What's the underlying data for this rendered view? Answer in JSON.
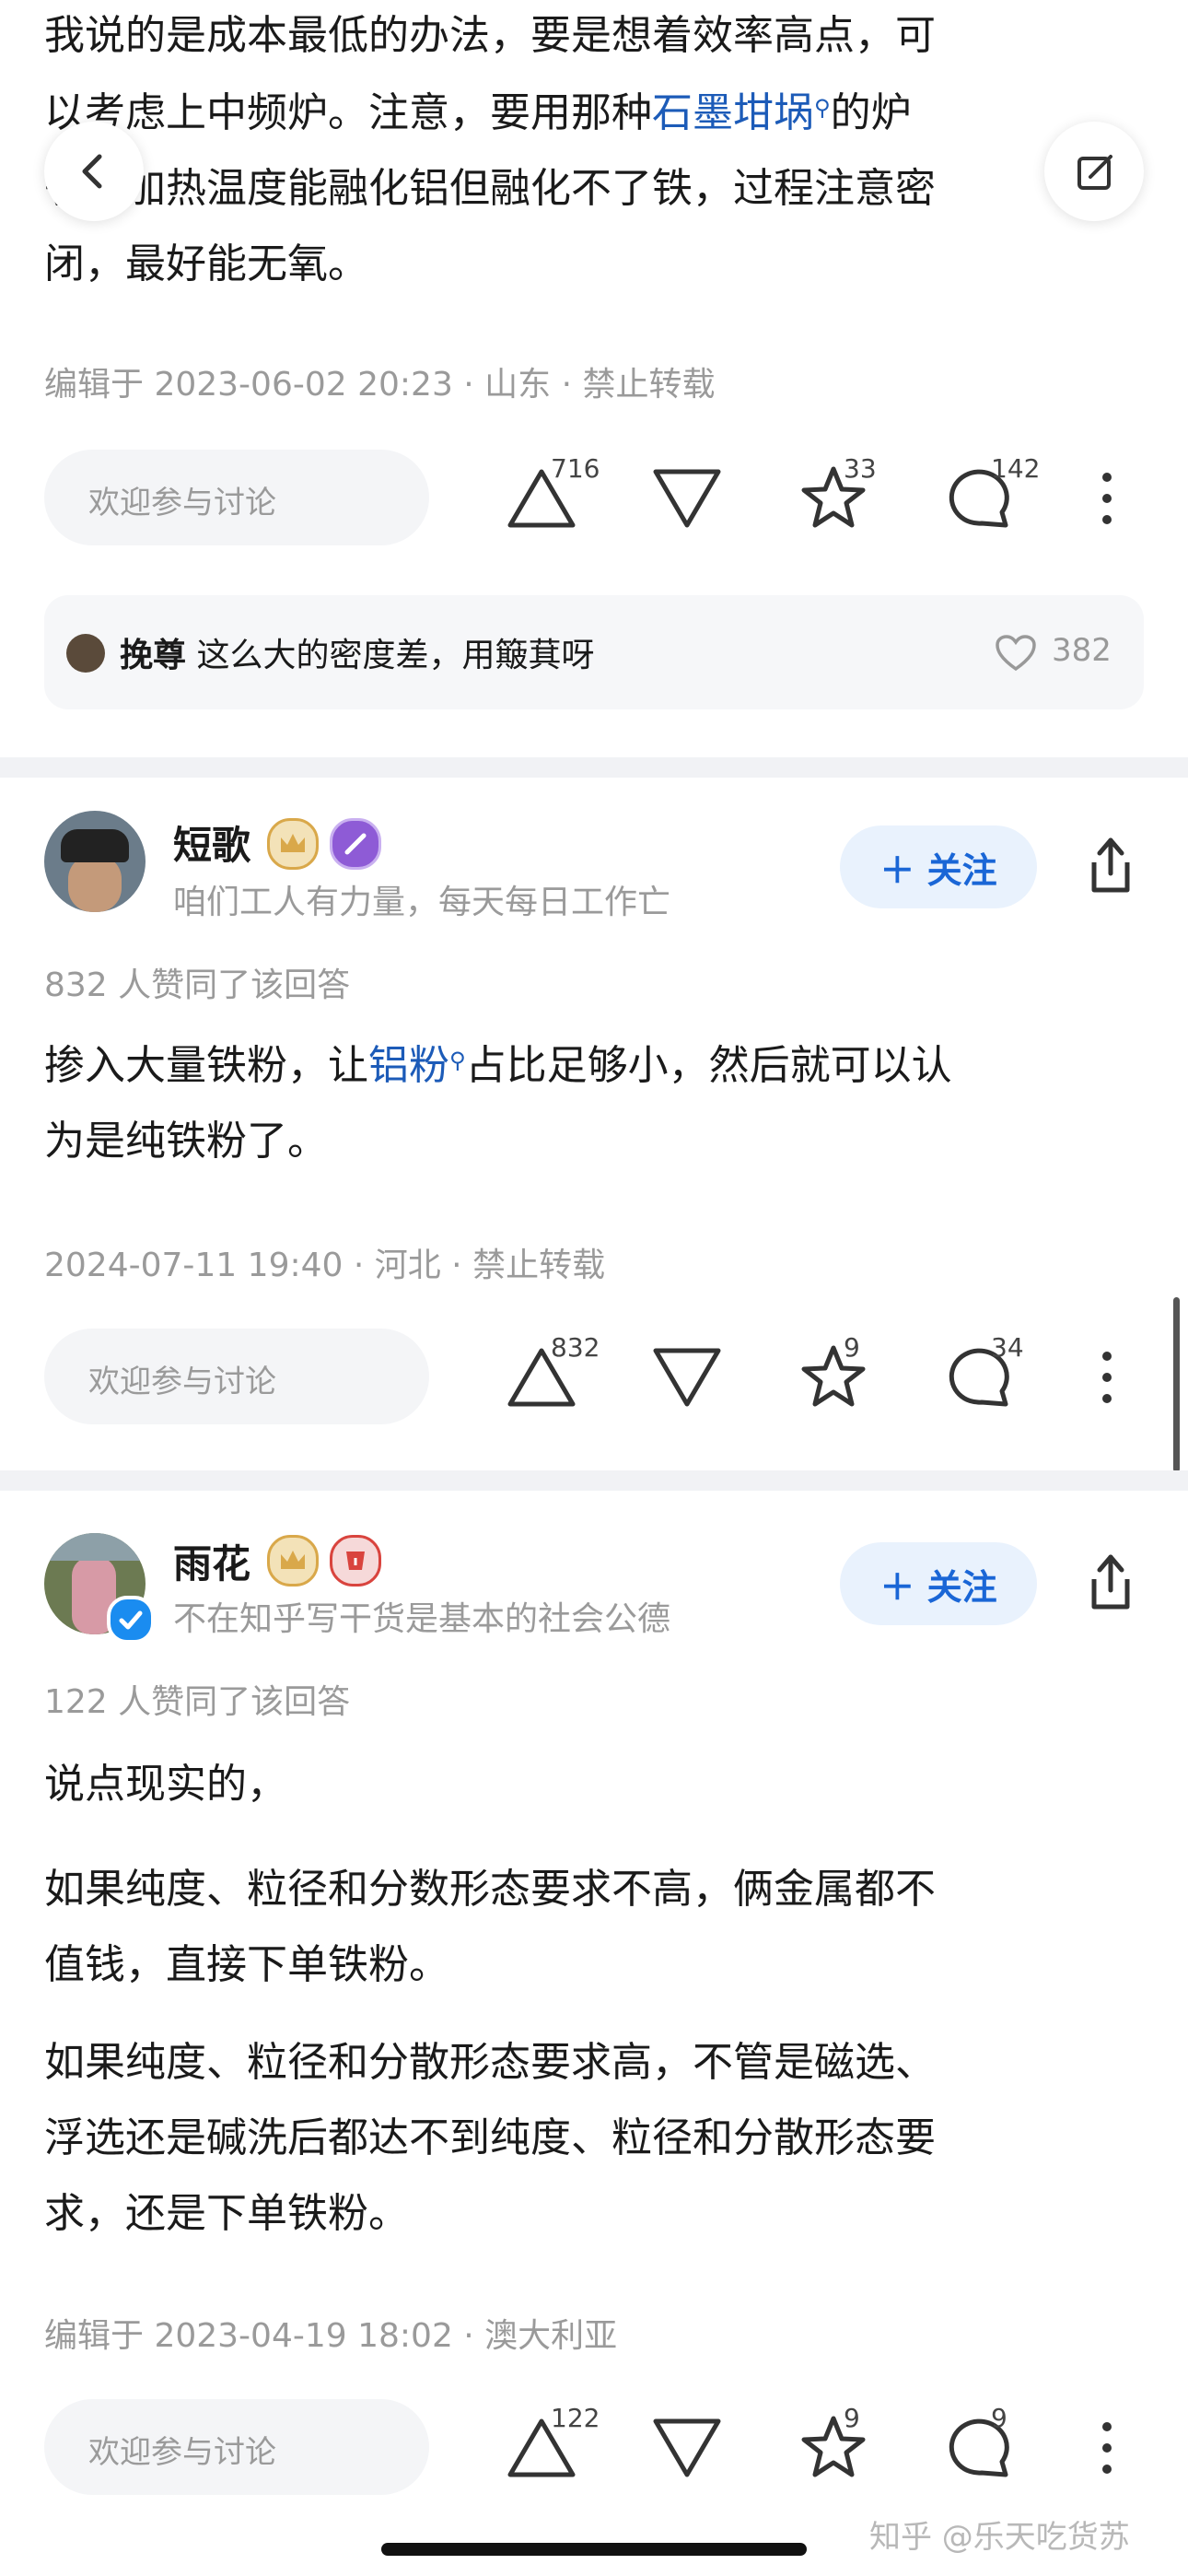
{
  "answer1": {
    "lines": [
      [
        "我说的是成本最低的办法，要是想着效率高点，可"
      ],
      [
        "以考虑上中频炉。注意，要用那种",
        "石墨坩埚",
        "的炉"
      ],
      [
        "子，加热温度能融化铝但融化不了铁，过程注意密"
      ],
      [
        "闭，最好能无氧。"
      ]
    ],
    "meta": "编辑于 2023-06-02 20:23 · 山东 · 禁止转载",
    "input_placeholder": "欢迎参与讨论",
    "upvotes": "716",
    "favorites": "33",
    "comments": "142",
    "top_comment": {
      "user": "挽尊",
      "text": "这么大的密度差，用簸萁呀",
      "likes": "382"
    }
  },
  "answer2": {
    "author": "短歌",
    "bio": "咱们工人有力量，每天每日工作亡",
    "follow_label": "＋ 关注",
    "agree": "832 人赞同了该回答",
    "content_line1_a": "掺入大量铁粉，让",
    "content_line1_link": "铝粉",
    "content_line1_b": "占比足够小，然后就可以认",
    "content_line2": "为是纯铁粉了。",
    "meta": "2024-07-11 19:40 · 河北 · 禁止转载",
    "input_placeholder": "欢迎参与讨论",
    "upvotes": "832",
    "favorites": "9",
    "comments": "34"
  },
  "answer3": {
    "author": "雨花",
    "bio": "不在知乎写干货是基本的社会公德",
    "follow_label": "＋ 关注",
    "agree": "122 人赞同了该回答",
    "p1": "说点现实的，",
    "p2_l1": "如果纯度、粒径和分数形态要求不高，俩金属都不",
    "p2_l2": "值钱，直接下单铁粉。",
    "p3_l1": "如果纯度、粒径和分散形态要求高，不管是磁选、",
    "p3_l2": "浮选还是碱洗后都达不到纯度、粒径和分散形态要",
    "p3_l3": "求，还是下单铁粉。",
    "meta": "编辑于 2023-04-19 18:02 · 澳大利亚",
    "input_placeholder": "欢迎参与讨论",
    "upvotes": "122",
    "favorites": "9",
    "comments": "9"
  },
  "watermark": "知乎 @乐天吃货苏",
  "colors": {
    "link": "#1c5bb8",
    "follow_text": "#1a66d6",
    "follow_bg": "#e9f2fd",
    "separator": "#f1f2f5",
    "meta": "#9a9a9a"
  }
}
